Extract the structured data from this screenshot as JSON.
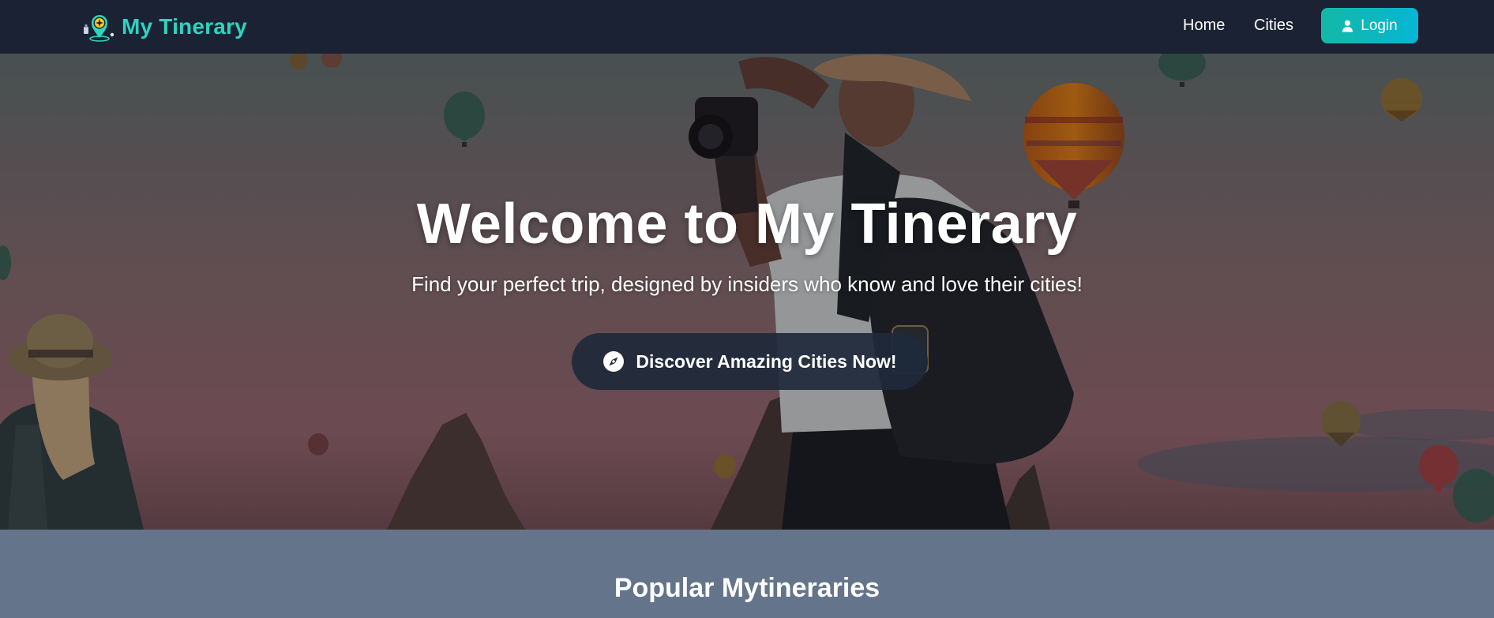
{
  "colors": {
    "navbar_bg": "#1a2234",
    "brand": "#2dd4bf",
    "login_gradient_start": "#14b8a6",
    "login_gradient_end": "#06b6d4",
    "cta_bg": "#1e293b",
    "section_bg": "#64748b"
  },
  "navbar": {
    "logo_icon": "map-pin-compass-icon",
    "brand": "My Tinerary",
    "links": [
      {
        "label": "Home"
      },
      {
        "label": "Cities"
      }
    ],
    "login": {
      "icon": "user-icon",
      "label": "Login"
    }
  },
  "hero": {
    "title": "Welcome to My Tinerary",
    "subtitle": "Find your perfect trip, designed by insiders who know and love their cities!",
    "cta": {
      "icon": "compass-icon",
      "label": "Discover Amazing Cities Now!"
    }
  },
  "popular": {
    "title": "Popular Mytineraries"
  }
}
